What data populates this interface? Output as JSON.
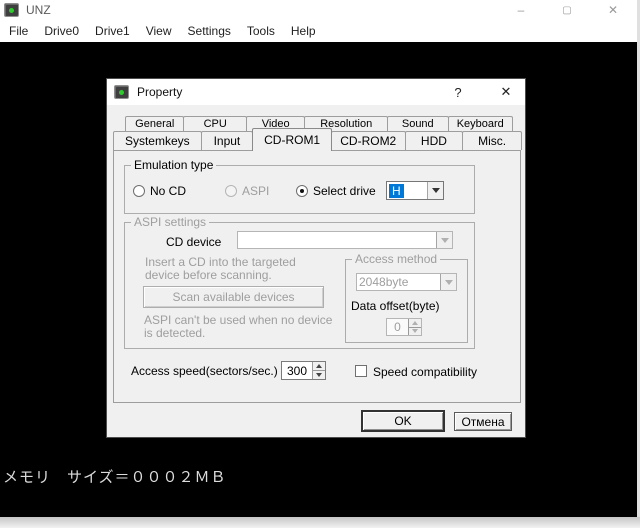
{
  "window": {
    "title": "UNZ",
    "menu": [
      "File",
      "Drive0",
      "Drive1",
      "View",
      "Settings",
      "Tools",
      "Help"
    ],
    "minimize_glyph": "–",
    "maximize_glyph": "▢",
    "close_glyph": "✕",
    "screen_text": "メモリ　サイズ＝０００２ＭＢ"
  },
  "dialog": {
    "title": "Property",
    "help_glyph": "?",
    "close_glyph": "✕",
    "tabs_row1": [
      "General",
      "CPU",
      "Video",
      "Resolution",
      "Sound",
      "Keyboard"
    ],
    "tabs_row2": [
      "Systemkeys",
      "Input",
      "CD-ROM1",
      "CD-ROM2",
      "HDD",
      "Misc."
    ],
    "selected_tab": "CD-ROM1",
    "emulation": {
      "legend": "Emulation type",
      "options": [
        {
          "label": "No CD",
          "selected": false,
          "disabled": false
        },
        {
          "label": "ASPI",
          "selected": false,
          "disabled": true
        },
        {
          "label": "Select drive",
          "selected": true,
          "disabled": false
        }
      ],
      "drive_value": "H"
    },
    "aspi": {
      "legend": "ASPI settings",
      "cd_device_label": "CD device",
      "cd_device_value": "",
      "hint_insert_line1": "Insert a CD into the targeted",
      "hint_insert_line2": "device before scanning.",
      "scan_button": "Scan available devices",
      "hint_no_device_line1": "ASPI can't be used when no device",
      "hint_no_device_line2": "is detected.",
      "access_method": {
        "legend": "Access method",
        "value": "2048byte",
        "data_offset_label": "Data offset(byte)",
        "data_offset_value": "0"
      }
    },
    "access_speed_label": "Access speed(sectors/sec.)",
    "access_speed_value": "300",
    "speed_compatibility_label": "Speed compatibility",
    "speed_compatibility_checked": false,
    "ok_label": "OK",
    "cancel_label": "Отмена"
  },
  "colors": {
    "selection_blue": "#0078d7",
    "disabled_text": "#9e9e9e",
    "dialog_bg": "#f0f0f0",
    "client_bg": "#000000",
    "screen_text_color": "#dcdcdc"
  }
}
